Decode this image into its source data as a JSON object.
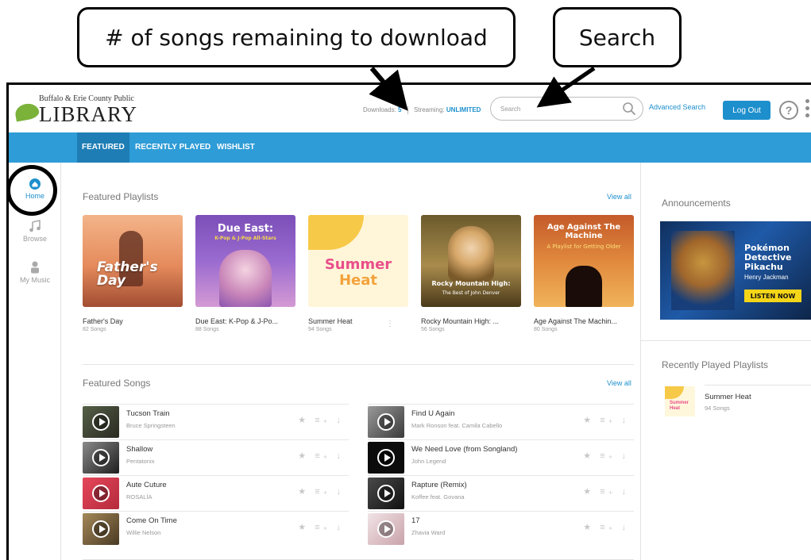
{
  "annotations": {
    "downloads_callout": "# of songs remaining to download",
    "search_callout": "Search"
  },
  "header": {
    "logo_small": "Buffalo & Erie County Public",
    "logo_big": "LIBRARY",
    "downloads_label": "Downloads:",
    "downloads_value": "5",
    "streaming_label": "Streaming:",
    "streaming_value": "UNLIMITED",
    "search_placeholder": "Search",
    "advanced_search": "Advanced Search",
    "logout": "Log Out",
    "help_glyph": "?"
  },
  "nav": {
    "tabs": [
      "FEATURED",
      "RECENTLY PLAYED",
      "WISHLIST"
    ],
    "active": "FEATURED"
  },
  "rail": {
    "items": [
      {
        "label": "Home",
        "icon": "home-icon"
      },
      {
        "label": "Browse",
        "icon": "music-note-icon"
      },
      {
        "label": "My Music",
        "icon": "person-icon"
      }
    ]
  },
  "featured_playlists": {
    "title": "Featured Playlists",
    "view_all": "View all",
    "items": [
      {
        "name": "Father's Day",
        "count": "82 Songs",
        "art_title": "Father's Day"
      },
      {
        "name": "Due East: K-Pop & J-Po...",
        "count": "88 Songs",
        "art_title": "Due East:",
        "art_subtitle": "K-Pop & J-Pop All-Stars"
      },
      {
        "name": "Summer Heat",
        "count": "94 Songs",
        "art_title": "Summer",
        "art_title2": "Heat"
      },
      {
        "name": "Rocky Mountain High: ...",
        "count": "56 Songs",
        "art_title": "Rocky Mountain High:",
        "art_subtitle": "The Best of John Denver"
      },
      {
        "name": "Age Against The Machin...",
        "count": "80 Songs",
        "art_title": "Age Against The Machine",
        "art_subtitle": "A Playlist for Getting Older"
      }
    ]
  },
  "featured_songs": {
    "title": "Featured Songs",
    "view_all": "View all",
    "left": [
      {
        "title": "Tucson Train",
        "artist": "Bruce Springsteen"
      },
      {
        "title": "Shallow",
        "artist": "Pentatonix"
      },
      {
        "title": "Aute Cuture",
        "artist": "ROSALÍA"
      },
      {
        "title": "Come On Time",
        "artist": "Willie Nelson"
      }
    ],
    "right": [
      {
        "title": "Find U Again",
        "artist": "Mark Ronson feat. Camila Cabello"
      },
      {
        "title": "We Need Love (from Songland)",
        "artist": "John Legend"
      },
      {
        "title": "Rapture (Remix)",
        "artist": "Koffee feat. Govana"
      },
      {
        "title": "17",
        "artist": "Zhavia Ward"
      }
    ],
    "actions": "★ ≡₊ ↓"
  },
  "announcements": {
    "title": "Announcements",
    "banner_title": "Pokémon Detective Pikachu",
    "banner_author": "Henry Jackman",
    "banner_cta": "LISTEN NOW"
  },
  "recently_played": {
    "title": "Recently Played Playlists",
    "items": [
      {
        "name": "Summer Heat",
        "count": "94 Songs",
        "thumb_text": "Summer Heat"
      }
    ]
  },
  "colors": {
    "accent": "#1d8fcc",
    "navbar": "#2e9cd6",
    "navbar_active": "#1e7db5"
  }
}
